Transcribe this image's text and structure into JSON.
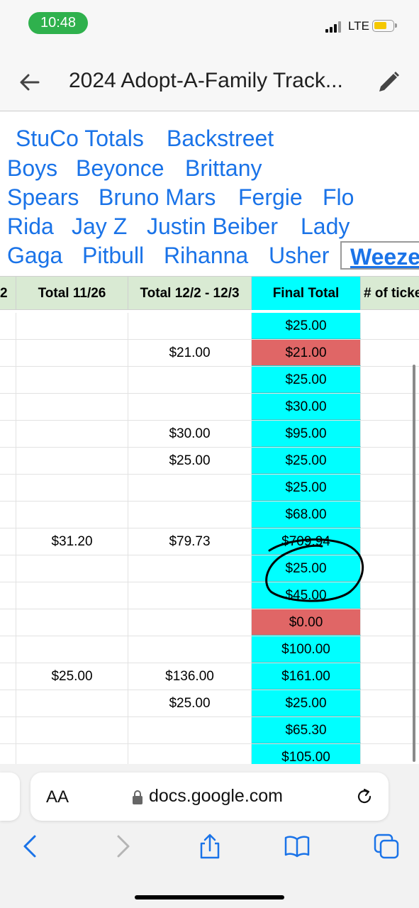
{
  "status_bar": {
    "time": "10:48",
    "network": "LTE"
  },
  "app_bar": {
    "title": "2024 Adopt-A-Family Track..."
  },
  "sheet_tabs": [
    "StuCo Totals",
    "Backstreet",
    "Boys",
    "Beyonce",
    "Brittany",
    "Spears",
    "Bruno Mars",
    "Fergie",
    "Flo",
    "Rida",
    "Jay Z",
    "Justin Beiber",
    "Lady",
    "Gaga",
    "Pitbull",
    "Rihanna",
    "Usher",
    "Weeze"
  ],
  "grid": {
    "headers": [
      "2",
      "Total 11/26",
      "Total 12/2 - 12/3",
      "Final Total",
      "# of ticke"
    ],
    "rows": [
      {
        "total_1126": "",
        "total_1202": "",
        "final": "$25.00",
        "final_color": "#00ffff"
      },
      {
        "total_1126": "",
        "total_1202": "$21.00",
        "final": "$21.00",
        "final_color": "#e06666"
      },
      {
        "total_1126": "",
        "total_1202": "",
        "final": "$25.00",
        "final_color": "#00ffff"
      },
      {
        "total_1126": "",
        "total_1202": "",
        "final": "$30.00",
        "final_color": "#00ffff"
      },
      {
        "total_1126": "",
        "total_1202": "$30.00",
        "final": "$95.00",
        "final_color": "#00ffff"
      },
      {
        "total_1126": "",
        "total_1202": "$25.00",
        "final": "$25.00",
        "final_color": "#00ffff"
      },
      {
        "total_1126": "",
        "total_1202": "",
        "final": "$25.00",
        "final_color": "#00ffff"
      },
      {
        "total_1126": "",
        "total_1202": "",
        "final": "$68.00",
        "final_color": "#00ffff"
      },
      {
        "total_1126": "$31.20",
        "total_1202": "$79.73",
        "final": "$709.94",
        "final_color": "#00ffff"
      },
      {
        "total_1126": "",
        "total_1202": "",
        "final": "$25.00",
        "final_color": "#00ffff"
      },
      {
        "total_1126": "",
        "total_1202": "",
        "final": "$45.00",
        "final_color": "#00ffff"
      },
      {
        "total_1126": "",
        "total_1202": "",
        "final": "$0.00",
        "final_color": "#e06666"
      },
      {
        "total_1126": "",
        "total_1202": "",
        "final": "$100.00",
        "final_color": "#00ffff"
      },
      {
        "total_1126": "$25.00",
        "total_1202": "$136.00",
        "final": "$161.00",
        "final_color": "#00ffff"
      },
      {
        "total_1126": "",
        "total_1202": "$25.00",
        "final": "$25.00",
        "final_color": "#00ffff"
      },
      {
        "total_1126": "",
        "total_1202": "",
        "final": "$65.30",
        "final_color": "#00ffff"
      },
      {
        "total_1126": "",
        "total_1202": "",
        "final": "$105.00",
        "final_color": "#00ffff"
      }
    ]
  },
  "browser": {
    "text_size_label": "AA",
    "url": "docs.google.com"
  },
  "colors": {
    "accent": "#1a73e8",
    "header_bg": "#d9ead3",
    "final_cyan": "#00ffff",
    "final_red": "#e06666",
    "time_pill": "#2fb14d"
  }
}
